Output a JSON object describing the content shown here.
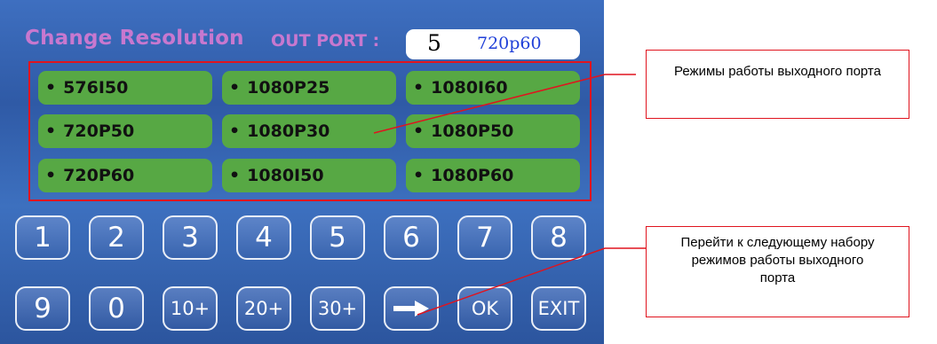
{
  "header": {
    "title": "Change Resolution",
    "out_port_label": "OUT PORT :",
    "port_number": "5",
    "port_mode": "720p60"
  },
  "modes": [
    [
      "576I50",
      "1080P25",
      "1080I60"
    ],
    [
      "720P50",
      "1080P30",
      "1080P50"
    ],
    [
      "720P60",
      "1080I50",
      "1080P60"
    ]
  ],
  "mode_bullet": "•",
  "keypad": {
    "row1": [
      "1",
      "2",
      "3",
      "4",
      "5",
      "6",
      "7",
      "8"
    ],
    "row2": [
      "9",
      "0",
      "10+",
      "20+",
      "30+",
      "",
      "OK",
      "EXIT"
    ]
  },
  "next_key_icon": "arrow-right-icon",
  "callouts": {
    "modes": "Режимы работы выходного порта",
    "next": "Перейти к следующему набору режимов работы выходного порта"
  },
  "colors": {
    "screen_bg": "#3461b0",
    "title": "#c878cf",
    "mode_button": "#57a844",
    "callout_border": "#e0141e",
    "port_mode_text": "#1f3fd8"
  }
}
